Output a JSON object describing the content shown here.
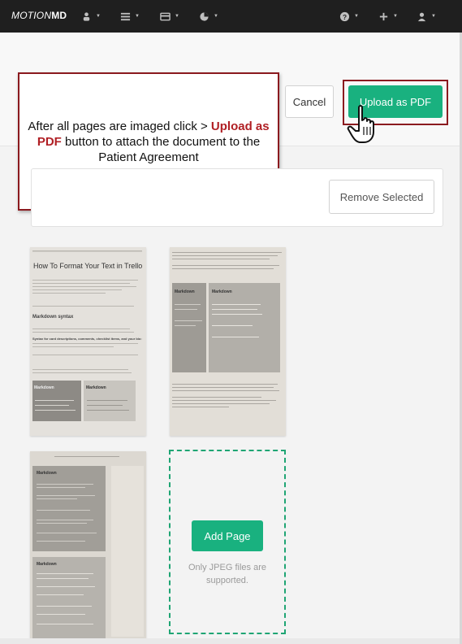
{
  "brand": {
    "part1": "MOTION",
    "part2": "MD"
  },
  "nav": {
    "items": [
      {
        "icon": "user-group-icon"
      },
      {
        "icon": "grid-icon"
      },
      {
        "icon": "card-icon"
      },
      {
        "icon": "pie-chart-icon"
      }
    ],
    "right_items": [
      {
        "icon": "help-icon"
      },
      {
        "icon": "plus-icon"
      },
      {
        "icon": "user-icon"
      }
    ]
  },
  "toolbar": {
    "cancel_label": "Cancel",
    "upload_label": "Upload as PDF"
  },
  "callout": {
    "text_before": "After all pages are imaged click > ",
    "highlight": "Upload as PDF",
    "text_after": " button to attach the document to the Patient Agreement"
  },
  "panel": {
    "remove_label": "Remove Selected"
  },
  "uploader": {
    "add_label": "Add Page",
    "note": "Only JPEG files are supported."
  },
  "thumbnails": {
    "t1": {
      "title": "How To Format Your Text in Trello",
      "heading": "Markdown syntax",
      "subheading": "Syntax for card descriptions, comments, checklist items, and your bio:",
      "col1": "Markdown",
      "col2": "Markdown"
    },
    "t2": {
      "col1": "Markdown",
      "col2": "Markdown"
    },
    "t3": {
      "col1": "Markdown",
      "col2": "Markdown"
    }
  },
  "colors": {
    "accent": "#19b17f",
    "callout_border": "#8b1a1f",
    "highlight": "#b01f24",
    "navbar": "#1f1f1f"
  }
}
